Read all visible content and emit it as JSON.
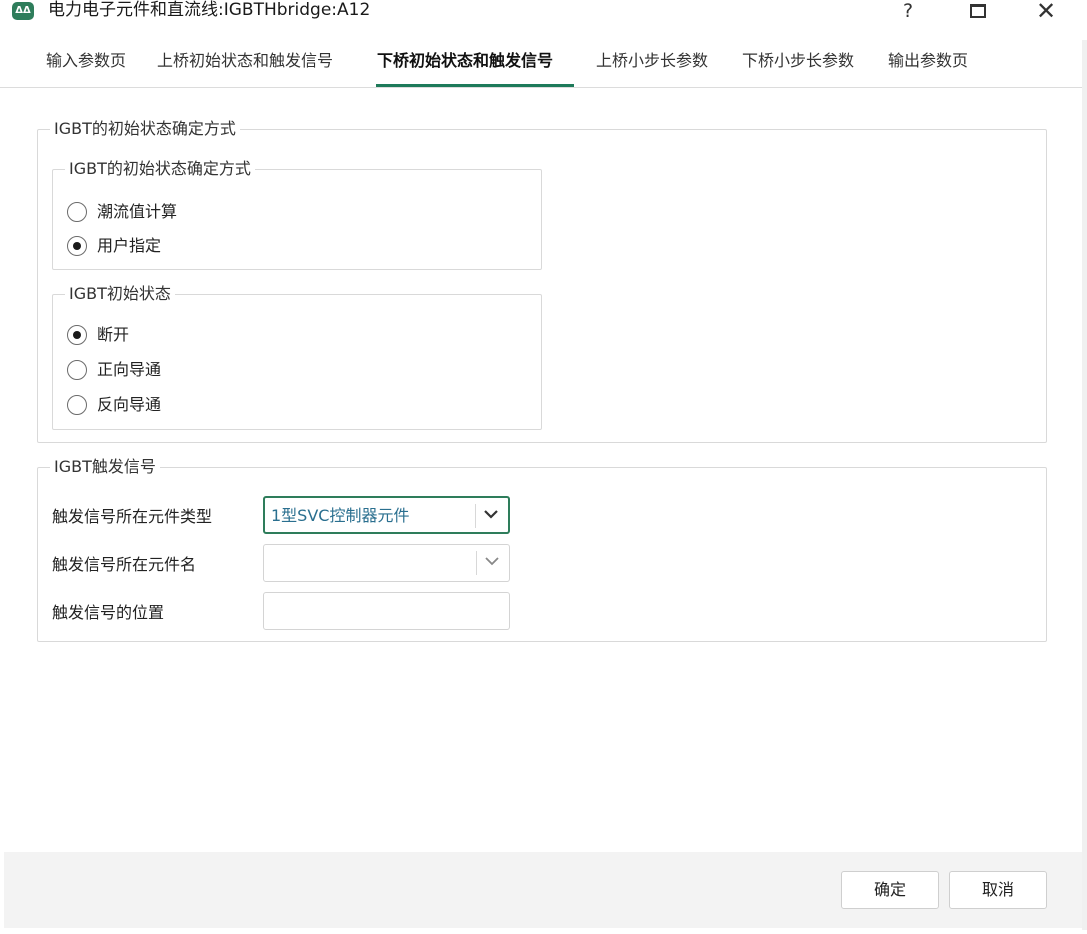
{
  "window": {
    "title": "电力电子元件和直流线:IGBTHbridge:A12",
    "help_label": "?",
    "close_label": "✕"
  },
  "tabs": [
    {
      "label": "输入参数页"
    },
    {
      "label": "上桥初始状态和触发信号"
    },
    {
      "label": "下桥初始状态和触发信号",
      "active": true
    },
    {
      "label": "上桥小步长参数"
    },
    {
      "label": "下桥小步长参数"
    },
    {
      "label": "输出参数页"
    }
  ],
  "init_group": {
    "label": "IGBT的初始状态确定方式",
    "method_group": {
      "label": "IGBT的初始状态确定方式",
      "options": [
        {
          "label": "潮流值计算",
          "checked": false
        },
        {
          "label": "用户指定",
          "checked": true
        }
      ]
    },
    "state_group": {
      "label": "IGBT初始状态",
      "options": [
        {
          "label": "断开",
          "checked": true
        },
        {
          "label": "正向导通",
          "checked": false
        },
        {
          "label": "反向导通",
          "checked": false
        }
      ]
    }
  },
  "trigger_group": {
    "label": "IGBT触发信号",
    "fields": {
      "component_type_label": "触发信号所在元件类型",
      "component_type_value": "1型SVC控制器元件",
      "component_name_label": "触发信号所在元件名",
      "component_name_value": "",
      "position_label": "触发信号的位置",
      "position_value": ""
    }
  },
  "footer": {
    "ok_label": "确定",
    "cancel_label": "取消"
  },
  "colors": {
    "accent": "#1e7a5a",
    "combo_text": "#2a6f8f",
    "footer_bg": "#f3f3f3"
  }
}
